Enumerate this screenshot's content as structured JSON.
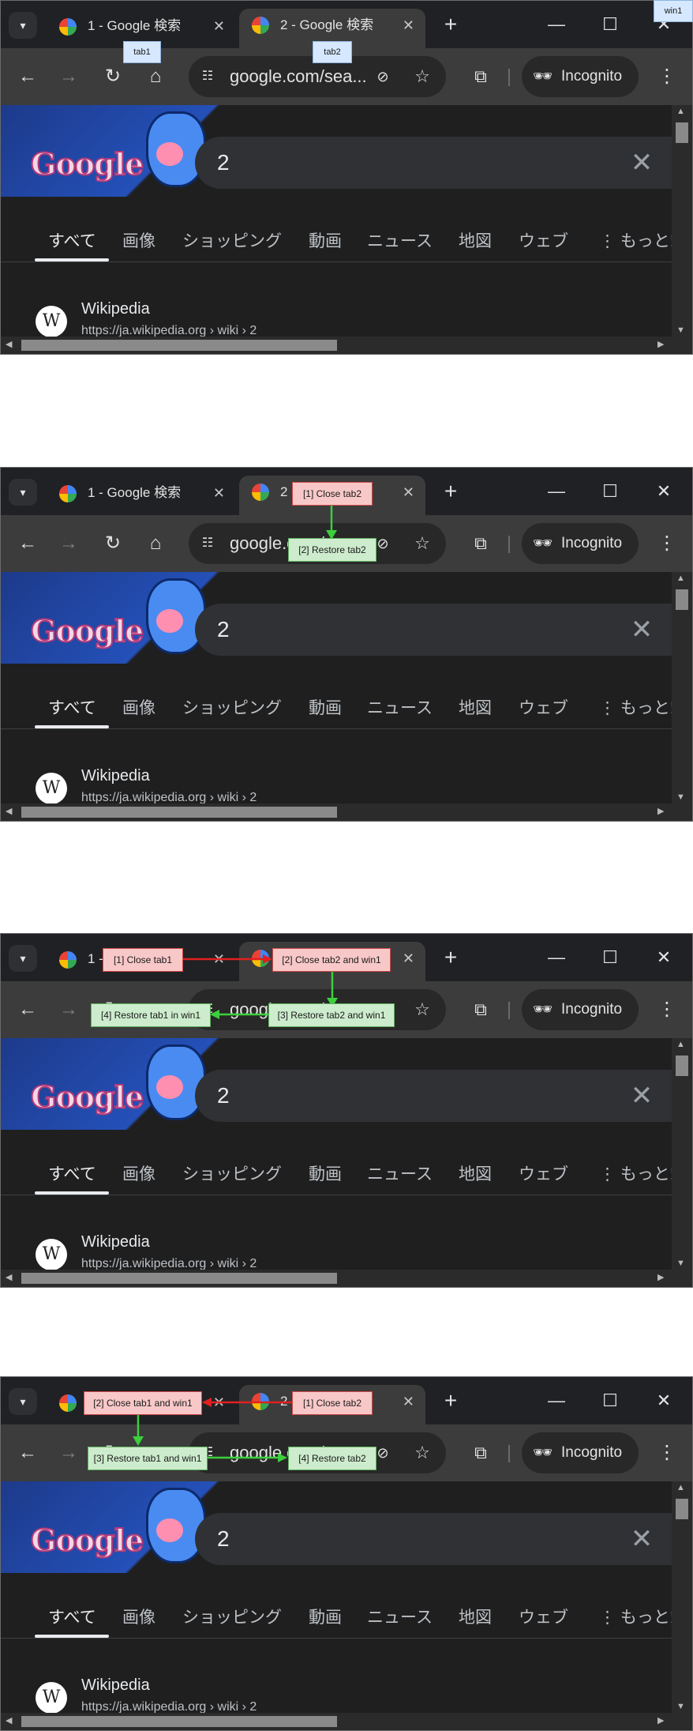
{
  "browser": {
    "tab1_title": "1 - Google 検索",
    "tab2_title": "2 - Google 検索",
    "url": "google.com/sea...",
    "incognito_label": "Incognito",
    "search_value": "2",
    "nav_items": [
      "すべて",
      "画像",
      "ショッピング",
      "動画",
      "ニュース",
      "地図",
      "ウェブ",
      "⋮ もっと!"
    ],
    "result_title": "Wikipedia",
    "result_url": "https://ja.wikipedia.org › wiki › 2",
    "doodle_text": "Google"
  },
  "panels": [
    {
      "labels": {
        "win1": "win1",
        "tab1": "tab1",
        "tab2": "tab2"
      },
      "steps": []
    },
    {
      "steps": [
        {
          "text": "[1] Close tab2",
          "kind": "close"
        },
        {
          "text": "[2] Restore tab2",
          "kind": "restore"
        }
      ]
    },
    {
      "steps": [
        {
          "text": "[1] Close tab1",
          "kind": "close"
        },
        {
          "text": "[2] Close tab2 and win1",
          "kind": "close"
        },
        {
          "text": "[3] Restore tab2 and win1",
          "kind": "restore"
        },
        {
          "text": "[4] Restore tab1 in win1",
          "kind": "restore"
        }
      ]
    },
    {
      "steps": [
        {
          "text": "[1] Close tab2",
          "kind": "close"
        },
        {
          "text": "[2] Close tab1 and win1",
          "kind": "close"
        },
        {
          "text": "[3] Restore tab1 and win1",
          "kind": "restore"
        },
        {
          "text": "[4] Restore tab2",
          "kind": "restore"
        }
      ]
    }
  ],
  "colors": {
    "close_arrow": "#e02020",
    "restore_arrow": "#3ccf3c",
    "browser_bg": "#1f1f1f"
  }
}
